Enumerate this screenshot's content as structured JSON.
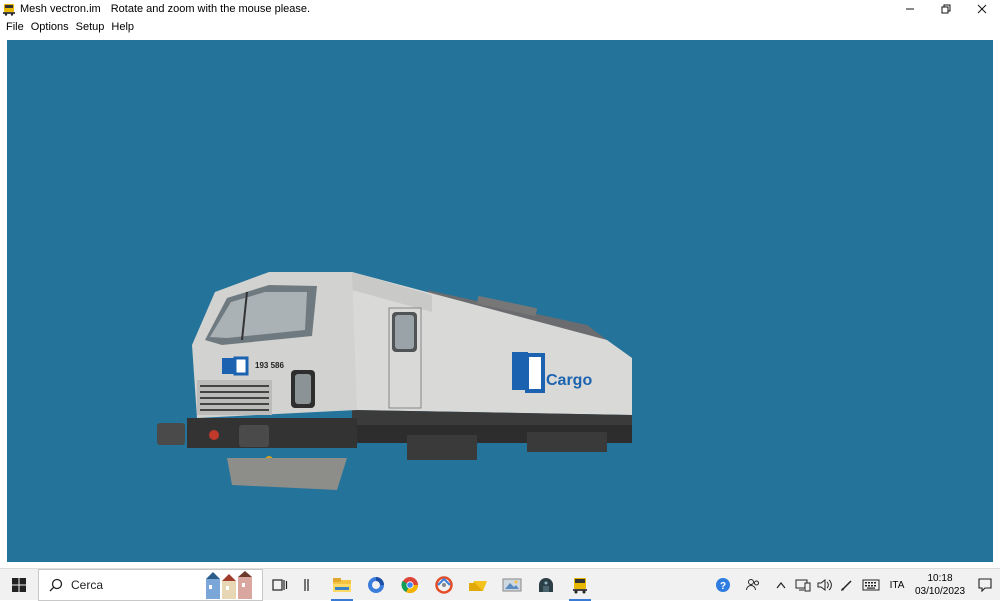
{
  "window": {
    "title": "Mesh vectron.im",
    "message": "Rotate and zoom with the mouse please.",
    "icon": "locomotive-icon",
    "controls": [
      "minimize-icon",
      "restore-icon",
      "close-icon"
    ]
  },
  "menu": {
    "items": [
      {
        "label": "File"
      },
      {
        "label": "Options"
      },
      {
        "label": "Setup"
      },
      {
        "label": "Help"
      }
    ]
  },
  "viewport": {
    "background": "#24739a",
    "model": {
      "number": "193 586",
      "brand": "Cargo",
      "body_color": "#d4d4d2",
      "logo_color": "#1b63b1"
    }
  },
  "taskbar": {
    "search_placeholder": "Cerca",
    "apps": [
      "task-view-icon",
      "widgets-icon",
      "file-explorer-icon",
      "browser-icon",
      "chrome-icon",
      "app-icon",
      "folder-icon",
      "photos-icon",
      "dark-app-icon",
      "locomotive-app-icon"
    ],
    "language": "ITA",
    "time": "10:18",
    "date": "03/10/2023"
  }
}
